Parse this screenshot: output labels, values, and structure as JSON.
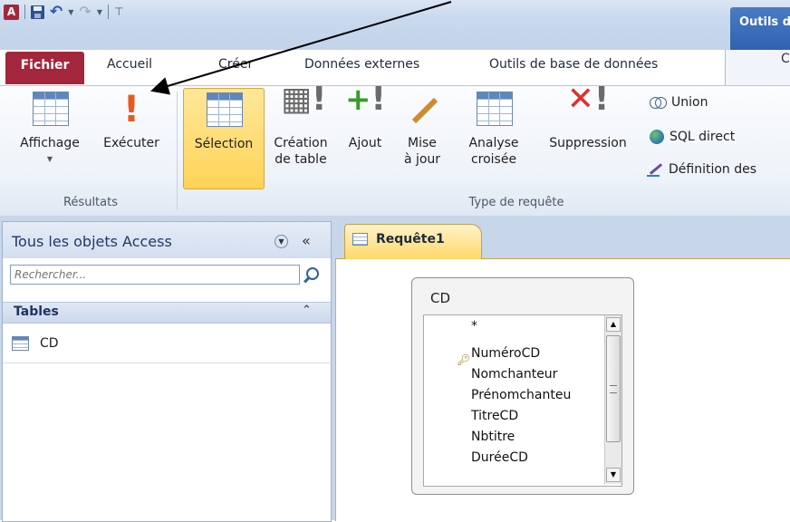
{
  "app": {
    "logo_letter": "A",
    "contextual_tab": "Outils de",
    "colors": {
      "file_tab": "#a4263c",
      "contextual": "#2f62b0",
      "selected": "#ffd356"
    }
  },
  "ribbon_tabs": {
    "fichier": "Fichier",
    "accueil": "Accueil",
    "creer": "Créer",
    "donnees": "Données externes",
    "outils_bd": "Outils de base de données",
    "partial": "C"
  },
  "ribbon": {
    "resultats": {
      "group_label": "Résultats",
      "affichage": "Affichage",
      "executer": "Exécuter"
    },
    "type_requete": {
      "group_label": "Type de requête",
      "selection": "Sélection",
      "creation_l1": "Création",
      "creation_l2": "de table",
      "ajout": "Ajout",
      "mise_l1": "Mise",
      "mise_l2": "à jour",
      "analyse_l1": "Analyse",
      "analyse_l2": "croisée",
      "suppression": "Suppression",
      "union": "Union",
      "sql": "SQL direct",
      "definition": "Définition des"
    }
  },
  "nav": {
    "title": "Tous les objets Access",
    "search_placeholder": "Rechercher...",
    "section": "Tables",
    "items": [
      "CD"
    ]
  },
  "document": {
    "tab_label": "Requête1",
    "field_list": {
      "title": "CD",
      "fields": [
        "*",
        "NuméroCD",
        "Nomchanteur",
        "Prénomchanteu",
        "TitreCD",
        "Nbtitre",
        "DuréeCD"
      ]
    }
  }
}
